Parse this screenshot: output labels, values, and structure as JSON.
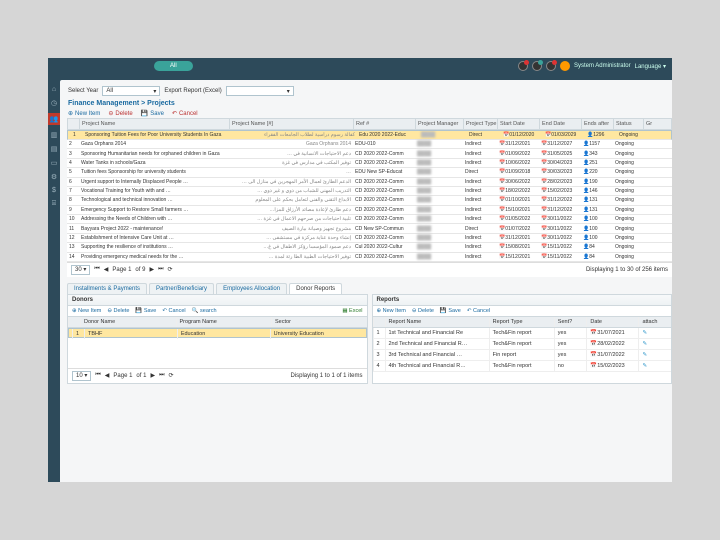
{
  "header": {
    "pill": "All",
    "user": "System Administrator",
    "lang": "Language ▾"
  },
  "filters": {
    "selectYearLabel": "Select Year",
    "selectYearValue": "All",
    "exportLabel": "Export Report (Excel)"
  },
  "crumb": "Finance Management > Projects",
  "toolbar": {
    "new": "New Item",
    "delete": "Delete",
    "save": "Save",
    "cancel": "Cancel"
  },
  "grid": {
    "cols": [
      "",
      "Project Name",
      "Project Name [#]",
      "Ref #",
      "Project Manager",
      "Project Type",
      "Start Date",
      "End Date",
      "Ends after",
      "Status",
      "Gr"
    ],
    "rows": [
      {
        "n": "1",
        "name": "Sponsoring Tuition Fees for Poor University Students In Gaza",
        "ar": "كفالة رسوم دراسية لطلاب الجامعات الفقراء",
        "ref": "Edu 2020 2022-Educ",
        "pm": "EDU-…",
        "type": "Direct",
        "start": "01/12/2020",
        "end": "01/03/2029",
        "after": "1296",
        "status": "Ongoing",
        "sel": true
      },
      {
        "n": "2",
        "name": "Gaza Orphans 2014",
        "ar": "Gaza Orphans 2014",
        "ref": "EDU-010",
        "pm": "",
        "type": "Indirect",
        "start": "31/12/2021",
        "end": "31/12/2027",
        "after": "1157",
        "status": "Ongoing"
      },
      {
        "n": "3",
        "name": "Sponsoring Humanitarian needs for orphaned children in Gaza",
        "ar": "دعم الاحتياجات الانسانية في …",
        "ref": "CD 2020 2022-Comm",
        "pm": "",
        "type": "Indirect",
        "start": "01/09/2022",
        "end": "31/05/2025",
        "after": "343",
        "status": "Ongoing"
      },
      {
        "n": "4",
        "name": "Water Tanks in schools/Gaza",
        "ar": "توفير المكتب في مدارس في غزة",
        "ref": "CD 2020 2022-Comm",
        "pm": "",
        "type": "Indirect",
        "start": "10/06/2022",
        "end": "30/04/2023",
        "after": "251",
        "status": "Ongoing"
      },
      {
        "n": "5",
        "name": "Tuition fees Sponsorship for university students",
        "ar": "…",
        "ref": "EDU New SP-Educat",
        "pm": "",
        "type": "Direct",
        "start": "01/09/2018",
        "end": "30/03/2023",
        "after": "220",
        "status": "Ongoing"
      },
      {
        "n": "6",
        "name": "Urgent support to Internally Displaced People …",
        "ar": "الدعم الطارئ لعمال الأمر المهجرين في منازل الى …",
        "ref": "CD 2020 2022-Comm",
        "pm": "",
        "type": "Indirect",
        "start": "30/06/2022",
        "end": "28/02/2023",
        "after": "190",
        "status": "Ongoing"
      },
      {
        "n": "7",
        "name": "Vocational Training for Youth with and …",
        "ar": "التدريب المهني للشباب من ذوي و غير ذوي …",
        "ref": "CD 2020 2022-Comm",
        "pm": "",
        "type": "Indirect",
        "start": "18/02/2022",
        "end": "15/02/2023",
        "after": "146",
        "status": "Ongoing"
      },
      {
        "n": "8",
        "name": "Technological and technical innovation …",
        "ar": "الابداع التقني والفني لتعامل بحكم على المعلوم",
        "ref": "CD 2020 2022-Comm",
        "pm": "",
        "type": "Indirect",
        "start": "01/10/2021",
        "end": "31/12/2022",
        "after": "131",
        "status": "Ongoing"
      },
      {
        "n": "9",
        "name": "Emergency Support to Restore Small farmers …",
        "ar": "دعم طارئ لإعادة مصائد الأرزاق للمزا…",
        "ref": "CD 2020 2022-Comm",
        "pm": "",
        "type": "Indirect",
        "start": "15/10/2021",
        "end": "31/12/2022",
        "after": "131",
        "status": "Ongoing"
      },
      {
        "n": "10",
        "name": "Addressing the Needs of Children with …",
        "ar": "تلبية احتياجات من صرحهم الاعمال في غزة …",
        "ref": "CD 2020 2022-Comm",
        "pm": "",
        "type": "Indirect",
        "start": "01/05/2022",
        "end": "30/11/2022",
        "after": "100",
        "status": "Ongoing"
      },
      {
        "n": "11",
        "name": "Bayyara Project 2022 - maintenance!",
        "ar": "مشروع تجهيز وصيانة بيارة الصيف",
        "ref": "CD New SP-Commun",
        "pm": "",
        "type": "Direct",
        "start": "01/07/2022",
        "end": "30/11/2022",
        "after": "100",
        "status": "Ongoing"
      },
      {
        "n": "12",
        "name": "Establishment of Intensive Care Unit at …",
        "ar": "إنشاء وحدة عناية مركزة في مستشفى …",
        "ref": "CD 2020 2022-Comm",
        "pm": "",
        "type": "Indirect",
        "start": "31/12/2021",
        "end": "30/11/2022",
        "after": "100",
        "status": "Ongoing"
      },
      {
        "n": "13",
        "name": "Supporting the resilience of institutions …",
        "ar": "دعم صمود المؤسسا رؤكز الاطفال في غ…",
        "ref": "Cul 2020 2022-Cultur",
        "pm": "",
        "type": "Indirect",
        "start": "15/08/2021",
        "end": "15/11/2022",
        "after": "84",
        "status": "Ongoing"
      },
      {
        "n": "14",
        "name": "Providing emergency medical needs for the …",
        "ar": "توفير الاحتياجات الطبية الطا رئة لمدة …",
        "ref": "CD 2020 2022-Comm",
        "pm": "",
        "type": "Indirect",
        "start": "15/12/2021",
        "end": "15/11/2022",
        "after": "84",
        "status": "Ongoing"
      }
    ],
    "pagerSize": "30 ▾",
    "pagerPage": "Page 1",
    "pagerOf": "of 9",
    "pagerInfo": "Displaying 1 to 30 of 256 items"
  },
  "tabs": [
    "Installments & Payments",
    "Partner/Beneficiary",
    "Employees Allocation",
    "Donor Reports"
  ],
  "activeTab": 3,
  "donors": {
    "title": "Donors",
    "cols": [
      "",
      "Donor Name",
      "Program Name",
      "Sector"
    ],
    "row": {
      "n": "1",
      "donor": "TBHF",
      "program": "Education",
      "sector": "University Education"
    },
    "pagerPage": "Page 1",
    "pagerOf": "of 1",
    "pagerInfo": "Displaying 1 to 1 of 1 items",
    "search": "search",
    "excel": "Excel"
  },
  "reports": {
    "title": "Reports",
    "cols": [
      "",
      "Report Name",
      "Report Type",
      "Sent?",
      "Date",
      "attach"
    ],
    "rows": [
      {
        "n": "1",
        "name": "1st Technical and Financial Re",
        "type": "Tech&Fin report",
        "sent": "yes",
        "date": "31/07/2021"
      },
      {
        "n": "2",
        "name": "2nd Technical and Financial R…",
        "type": "Tech&Fin report",
        "sent": "yes",
        "date": "28/02/2022"
      },
      {
        "n": "3",
        "name": "3rd Technical and Financial …",
        "type": "Fin report",
        "sent": "yes",
        "date": "31/07/2022"
      },
      {
        "n": "4",
        "name": "4th Technical and Financial R…",
        "type": "Tech&Fin report",
        "sent": "no",
        "date": "15/02/2023"
      }
    ]
  }
}
